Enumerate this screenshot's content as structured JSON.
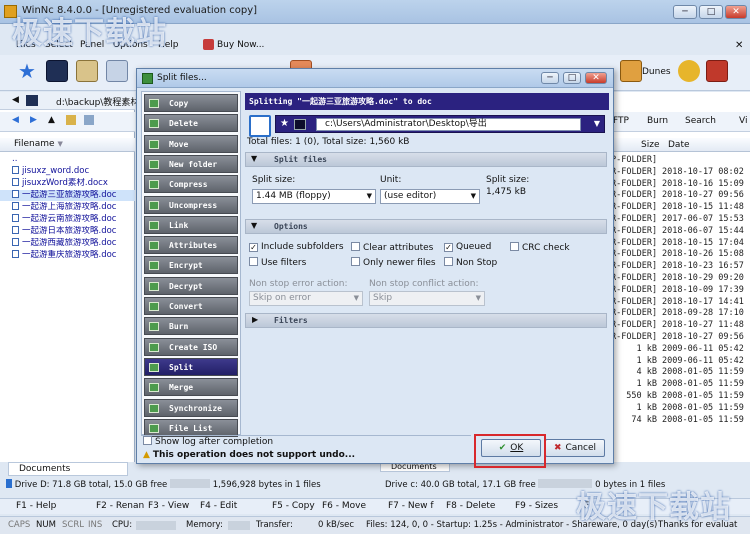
{
  "window": {
    "title": "WinNc 8.4.0.0 - [Unregistered evaluation copy]"
  },
  "menu": {
    "items": [
      "Files",
      "Select",
      "Panel",
      "Options",
      "Help",
      "Buy Now..."
    ]
  },
  "left_panel": {
    "path": "d:\\backup\\教程素材\\",
    "column_filename": "Filename",
    "parent_entry": "..",
    "files": [
      "jisuxz_word.doc",
      "jisuxzWord素材.docx",
      "一起游三亚旅游攻略.doc",
      "一起游上海旅游攻略.doc",
      "一起游云南旅游攻略.doc",
      "一起游日本旅游攻略.doc",
      "一起游西藏旅游攻略.doc",
      "一起游重庆旅游攻略.doc"
    ],
    "selected_index": 2,
    "tab": "Documents",
    "drive_info": "Drive D: 71.8 GB total, 15.0 GB free",
    "selection_info": "1,596,928 bytes in 1 files"
  },
  "right_panel": {
    "toolbar": [
      "Dunes",
      "FTP",
      "Burn",
      "Search",
      "Vi"
    ],
    "col_size": "Size",
    "col_date": "Date",
    "rows": [
      [
        "P-FOLDER]",
        ""
      ],
      [
        "R-FOLDER]",
        "2018-10-17 08:02"
      ],
      [
        "R-FOLDER]",
        "2018-10-16 15:09"
      ],
      [
        "R-FOLDER]",
        "2018-10-27 09:56"
      ],
      [
        "R-FOLDER]",
        "2018-10-15 11:48"
      ],
      [
        "R-FOLDER]",
        "2017-06-07 15:53"
      ],
      [
        "R-FOLDER]",
        "2018-06-07 15:44"
      ],
      [
        "R-FOLDER]",
        "2018-10-15 17:04"
      ],
      [
        "R-FOLDER]",
        "2018-10-26 15:08"
      ],
      [
        "R-FOLDER]",
        "2018-10-23 16:57"
      ],
      [
        "R-FOLDER]",
        "2018-10-29 09:20"
      ],
      [
        "R-FOLDER]",
        "2018-10-09 17:39"
      ],
      [
        "R-FOLDER]",
        "2018-10-17 14:41"
      ],
      [
        "R-FOLDER]",
        "2018-09-28 17:10"
      ],
      [
        "R-FOLDER]",
        "2018-10-27 11:48"
      ],
      [
        "R-FOLDER]",
        "2018-10-27 09:56"
      ],
      [
        "1 kB",
        "2009-06-11 05:42"
      ],
      [
        "1 kB",
        "2009-06-11 05:42"
      ],
      [
        "4 kB",
        "2008-01-05 11:59"
      ],
      [
        "1 kB",
        "2008-01-05 11:59"
      ],
      [
        "550 kB",
        "2008-01-05 11:59"
      ],
      [
        "1 kB",
        "2008-01-05 11:59"
      ],
      [
        "74 kB",
        "2008-01-05 11:59"
      ]
    ],
    "tab": "Documents",
    "drive_info": "Drive c: 40.0 GB total, 17.1 GB free",
    "selection_info": "0 bytes in 1 files"
  },
  "fnkeys": [
    "F1 - Help",
    "F2 - Renan",
    "F3 - View",
    "F4 - Edit",
    "F5 - Copy",
    "F6 - Move",
    "F7 - New f",
    "F8 - Delete",
    "F9 - Sizes",
    "F"
  ],
  "status": {
    "caps": "CAPS",
    "num": "NUM",
    "scrl": "SCRL",
    "ins": "INS",
    "cpu": "CPU:",
    "memory": "Memory:",
    "transfer": "Transfer:",
    "speed": "0 kB/sec",
    "info": "Files: 124, 0, 0 - Startup: 1.25s - Administrator - Shareware, 0 day(s)",
    "thanks": "Thanks for evaluat"
  },
  "dialog": {
    "title": "Split files...",
    "commands": [
      "Copy",
      "Delete",
      "Move",
      "New folder",
      "Compress",
      "Uncompress",
      "Link",
      "Attributes",
      "Encrypt",
      "Decrypt",
      "Convert",
      "Burn",
      "Create ISO",
      "Split",
      "Merge",
      "Synchronize",
      "File List"
    ],
    "selected_command": "Split",
    "header": "Splitting \"一起游三亚旅游攻略.doc\" to doc",
    "destination": "c:\\Users\\Administrator\\Desktop\\导出",
    "totals": "Total files: 1 (0), Total size: 1,560 kB",
    "section_split": "Split files",
    "split_size_label": "Split size:",
    "split_size_value": "1.44 MB (floppy)",
    "unit_label": "Unit:",
    "unit_value": "(use editor)",
    "split_size_info_label": "Split size:",
    "split_size_info_value": "1,475 kB",
    "section_options": "Options",
    "opt_include_subfolders": "Include subfolders",
    "opt_use_filters": "Use filters",
    "opt_clear_attributes": "Clear attributes",
    "opt_only_newer": "Only newer files",
    "opt_queued": "Queued",
    "opt_non_stop": "Non Stop",
    "opt_crc": "CRC check",
    "non_stop_error_label": "Non stop error action:",
    "non_stop_error_value": "Skip on error",
    "non_stop_conflict_label": "Non stop conflict action:",
    "non_stop_conflict_value": "Skip",
    "section_filters": "Filters",
    "show_log": "Show log after completion",
    "warning": "This operation does not support undo...",
    "ok": "OK",
    "cancel": "Cancel"
  },
  "watermark": "极速下载站",
  "colors": {
    "accent": "#2b2280",
    "highlight": "#d8282c"
  }
}
